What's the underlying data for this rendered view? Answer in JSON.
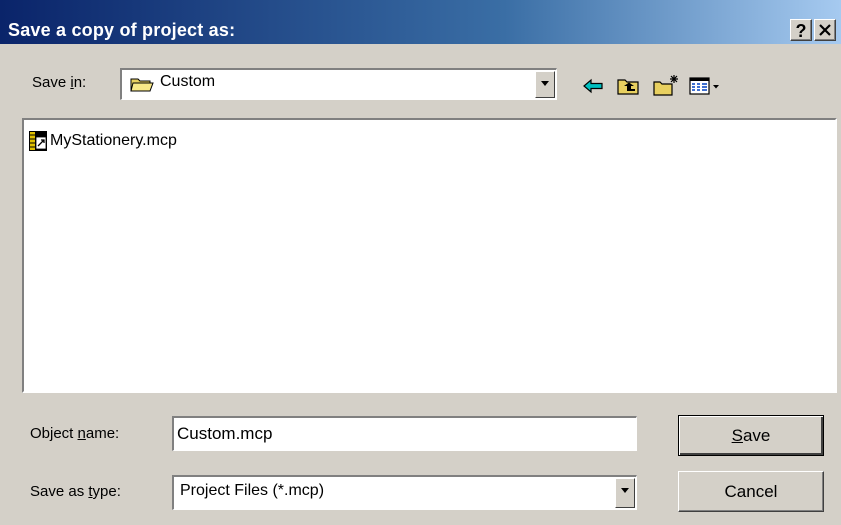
{
  "window": {
    "title": "Save a copy of project as:",
    "help_glyph": "?",
    "close_glyph": "✕"
  },
  "save_in": {
    "label_pre": "Save ",
    "label_accel": "i",
    "label_post": "n:",
    "value": "Custom",
    "icon": "folder-icon"
  },
  "toolbar": {
    "icons": [
      "back-arrow-icon",
      "up-one-level-icon",
      "create-new-folder-icon",
      "view-menu-icon"
    ]
  },
  "files": [
    {
      "name": "MyStationery.mcp",
      "icon": "project-file-icon"
    }
  ],
  "object_name": {
    "label_pre": "Object ",
    "label_accel": "n",
    "label_post": "ame:",
    "value": "Custom.mcp"
  },
  "save_as_type": {
    "label_pre": "Save as ",
    "label_accel": "t",
    "label_post": "ype:",
    "value": "Project Files (*.mcp)"
  },
  "buttons": {
    "save_accel": "S",
    "save_rest": "ave",
    "cancel": "Cancel"
  },
  "colors": {
    "title_start": "#0a246a",
    "title_end": "#a6caf0",
    "dialog_bg": "#d4d0c8",
    "arrow_cyan": "#00a0a0",
    "folder_yellow": "#e8d060"
  }
}
